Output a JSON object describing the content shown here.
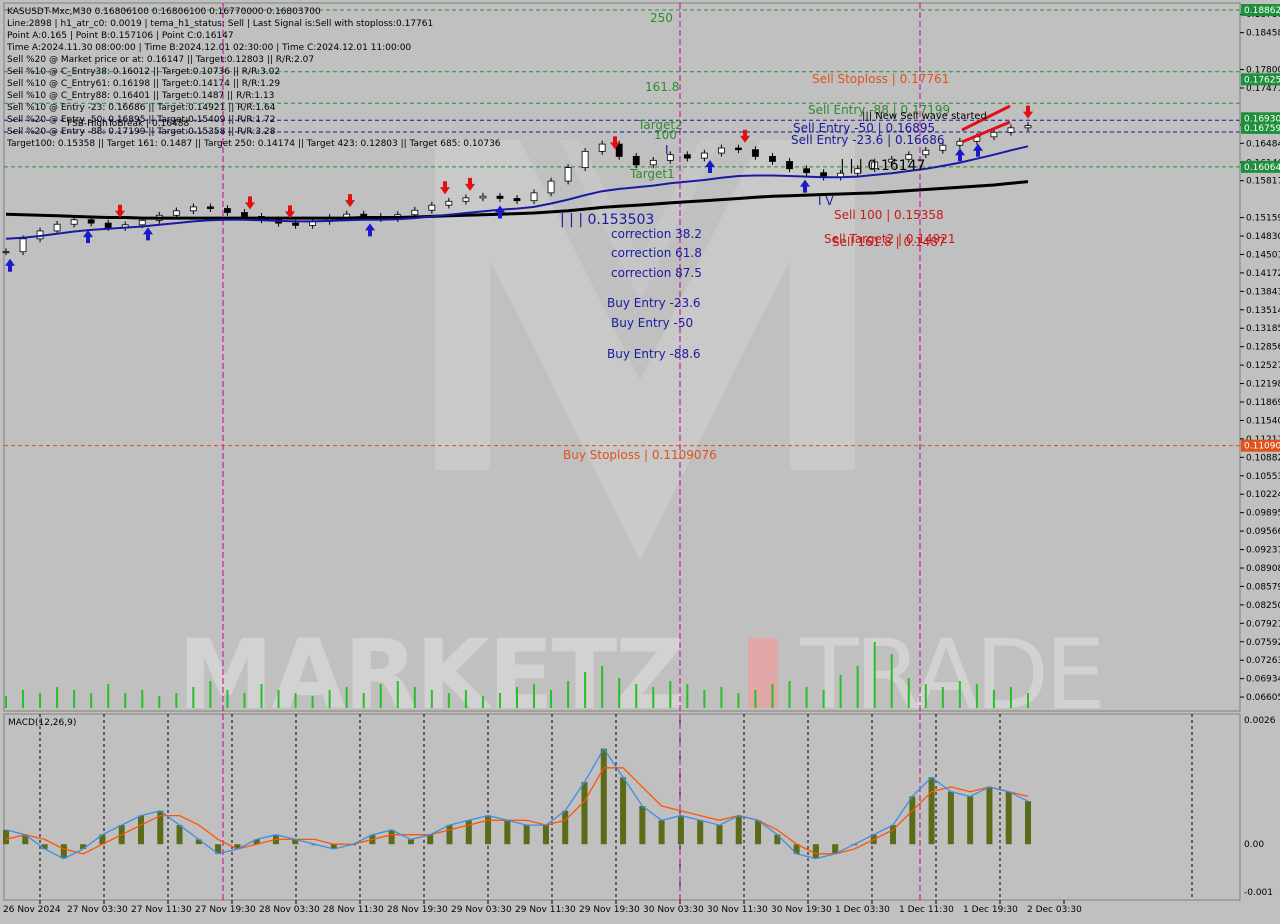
{
  "info_lines": [
    "KASUSDT-Mxc,M30  0.16806100 0.16806100 0.16770000 0.16803700",
    "Line:2898 | h1_atr_c0: 0.0019 | tema_h1_status: Sell | Last Signal is:Sell with stoploss:0.17761",
    "Point A:0.165 | Point B:0.157106 | Point C:0.16147",
    "Time A:2024.11.30 08:00:00 | Time B:2024.12.01 02:30:00 | Time C:2024.12.01 11:00:00",
    "Sell %20 @ Market price or at: 0.16147 || Target:0.12803 || R/R:2.07",
    "Sell %10 @ C_Entry38: 0.16012 || Target:0.10736 || R/R:3.02",
    "Sell %10 @ C_Entry61: 0.16198 || Target:0.14174 || R/R:1.29",
    "Sell %10 @ C_Entry88: 0.16401 || Target:0.1487 || R/R:1.13",
    "Sell %10 @ Entry -23: 0.16686 || Target:0.14921 || R/R:1.64",
    "Sell %20 @ Entry -50: 0.16895 || Target:0.15409 || R/R:1.72",
    "Sell %20 @ Entry -88: 0.17199 || Target:0.15358 || R/R:3.28",
    "Target100: 0.15358 || Target 161: 0.1487 || Target 250: 0.14174 || Target 423: 0.12803 || Target 685: 0.10736"
  ],
  "overlap_text": "FSB-HighToBreak | 0.16488",
  "price_axis": {
    "ticks": [
      "0.18787",
      "0.18458",
      "0.18129",
      "0.17800",
      "0.17471",
      "0.17142",
      "0.16813",
      "0.16484",
      "0.16146",
      "0.15817",
      "0.15488",
      "0.15159",
      "0.14830",
      "0.14501",
      "0.14172",
      "0.13843",
      "0.13514",
      "0.13185",
      "0.12856",
      "0.12527",
      "0.12198",
      "0.11869",
      "0.11540",
      "0.11211",
      "0.10882",
      "0.10553",
      "0.10224",
      "0.09895",
      "0.09566",
      "0.09237",
      "0.08908",
      "0.08579",
      "0.08250",
      "0.07921",
      "0.07592",
      "0.07263",
      "0.06934",
      "0.06605"
    ],
    "visible_ticks": [
      "0.18787",
      "0.18458",
      "0.17800",
      "0.17471",
      "0.16813",
      "0.16484",
      "0.16146",
      "0.15817",
      "0.15159",
      "0.14830",
      "0.14501",
      "0.14172",
      "0.13843",
      "0.13514",
      "0.13185",
      "0.12856",
      "0.12527",
      "0.12198",
      "0.11869",
      "0.11540",
      "0.11211",
      "0.10882",
      "0.10553",
      "0.10224",
      "0.09895",
      "0.09566",
      "0.09237",
      "0.08908",
      "0.08579",
      "0.08250",
      "0.07921",
      "0.07592",
      "0.07263",
      "0.06934",
      "0.06605"
    ]
  },
  "price_axis_labels": [
    "0.18787",
    "0.18458",
    "0.17800",
    "0.17471",
    "0.16813",
    "0.16484",
    "0.16146",
    "0.15817",
    "0.15159",
    "0.14830",
    "0.14501",
    "0.14172",
    "0.13843",
    "0.13514",
    "0.13185",
    "0.12856",
    "0.12527",
    "0.12198",
    "0.11869",
    "0.11540",
    "0.11211",
    "0.10882",
    "0.10553",
    "0.10224",
    "0.09895",
    "0.09566",
    "0.09237",
    "0.08908",
    "0.08579",
    "0.08250",
    "0.07921",
    "0.07592",
    "0.07263",
    "0.06934",
    "0.06605"
  ],
  "price_tags": [
    {
      "text": "0.18862",
      "color": "#1e8f3a",
      "price": 0.18862
    },
    {
      "text": "0.17625",
      "color": "#1e8f3a",
      "price": 0.17625
    },
    {
      "text": "0.16930",
      "color": "#1e8f3a",
      "price": 0.1693
    },
    {
      "text": "0.16759",
      "color": "#1e8f3a",
      "price": 0.16759
    },
    {
      "text": "0.16064",
      "color": "#1e8f3a",
      "price": 0.16064
    },
    {
      "text": "0.11090",
      "color": "#e0521a",
      "price": 0.1109
    }
  ],
  "macd_axis": [
    "0.0026",
    "0.00",
    "-0.001"
  ],
  "macd_label": "MACD(12,26,9)",
  "time_axis": [
    "26 Nov 2024",
    "27 Nov 03:30",
    "27 Nov 11:30",
    "27 Nov 19:30",
    "28 Nov 03:30",
    "28 Nov 11:30",
    "28 Nov 19:30",
    "29 Nov 03:30",
    "29 Nov 11:30",
    "29 Nov 19:30",
    "30 Nov 03:30",
    "30 Nov 11:30",
    "30 Nov 19:30",
    "1 Dec 03:30",
    "1 Dec 11:30",
    "1 Dec 19:30",
    "2 Dec 03:30"
  ],
  "chart_labels": {
    "t250": "250",
    "t1618": "161.8",
    "t100": "100",
    "target2": "Target2",
    "target1": "Target1",
    "sell_stoploss": "Sell Stoploss | 0.17761",
    "sell_entry_88": "Sell Entry -88 | 0.17199",
    "new_sell_wave": "||| New Sell wave started",
    "sell_entry_50": "Sell Entry -50 | 0.16895",
    "sell_entry_236": "Sell Entry -23.6 | 0.16686",
    "mid_level": "| | | 0.16147",
    "iv": "I V",
    "sell_100": "Sell 100 | 0.15358",
    "sell_target2": "Sell Target2 | 0.14921",
    "sell_1618": "Sell 161.8 | 0.1487",
    "left_level": "| | | 0.153503",
    "corr382": "correction 38.2",
    "corr618": "correction 61.8",
    "corr875": "correction 87.5",
    "buy236": "Buy Entry -23.6",
    "buy50": "Buy Entry -50",
    "buy886": "Buy Entry -88.6",
    "buy_stoploss": "Buy Stoploss | 0.1109076",
    "bar_i": "I"
  },
  "watermark": {
    "left": "MARKETZ",
    "mid": "I",
    "right": "TRADE"
  },
  "colors": {
    "bg": "#c0c0c0",
    "grid": "#a6a6a6",
    "candle": "#000000",
    "ma_blue": "#1a1aa0",
    "ma_black": "#000000",
    "red_line": "#e0521a",
    "green_line": "#2e8b2e",
    "magenta": "#c8008c",
    "macd_signal": "#ff5500",
    "macd_line": "#3b8ee8",
    "macd_hist": "#5a6b1a"
  },
  "chart_data": {
    "type": "line",
    "title": "KASUSDT-Mxc,M30",
    "ylim": [
      0.06446,
      0.18862
    ],
    "close_prices": [
      0.1455,
      0.1478,
      0.1492,
      0.1504,
      0.1512,
      0.1506,
      0.1498,
      0.1503,
      0.1511,
      0.152,
      0.1528,
      0.1535,
      0.1532,
      0.1525,
      0.1518,
      0.1512,
      0.1506,
      0.1502,
      0.1509,
      0.1516,
      0.1522,
      0.1518,
      0.1514,
      0.1521,
      0.1529,
      0.1538,
      0.1545,
      0.1551,
      0.1554,
      0.155,
      0.1546,
      0.156,
      0.1581,
      0.1605,
      0.1634,
      0.1647,
      0.1625,
      0.161,
      0.1618,
      0.1628,
      0.1622,
      0.1631,
      0.164,
      0.1637,
      0.1625,
      0.1616,
      0.1603,
      0.1596,
      0.1588,
      0.1595,
      0.1603,
      0.1615,
      0.162,
      0.1628,
      0.1636,
      0.1645,
      0.1652,
      0.166,
      0.1668,
      0.1676,
      0.168
    ],
    "ma_blue": [
      0.1478,
      0.148,
      0.1483,
      0.1487,
      0.1491,
      0.1494,
      0.1496,
      0.1498,
      0.15,
      0.1503,
      0.1506,
      0.1509,
      0.1511,
      0.1512,
      0.1512,
      0.1511,
      0.151,
      0.1509,
      0.1509,
      0.151,
      0.1511,
      0.1512,
      0.1512,
      0.1513,
      0.1515,
      0.1518,
      0.1521,
      0.1524,
      0.1527,
      0.153,
      0.1532,
      0.1535,
      0.1541,
      0.1548,
      0.1556,
      0.1563,
      0.1567,
      0.157,
      0.1573,
      0.1577,
      0.158,
      0.1583,
      0.1587,
      0.159,
      0.1591,
      0.1591,
      0.159,
      0.1589,
      0.1588,
      0.1588,
      0.1589,
      0.1592,
      0.1595,
      0.1599,
      0.1603,
      0.1608,
      0.1614,
      0.1621,
      0.1628,
      0.1636,
      0.1643
    ],
    "ma_black": [
      0.1522,
      0.1521,
      0.152,
      0.1519,
      0.1518,
      0.1517,
      0.1516,
      0.1516,
      0.1515,
      0.1515,
      0.1515,
      0.1515,
      0.1515,
      0.1515,
      0.1515,
      0.1515,
      0.1515,
      0.1515,
      0.1515,
      0.1515,
      0.1515,
      0.1516,
      0.1516,
      0.1516,
      0.1517,
      0.1518,
      0.1519,
      0.152,
      0.1521,
      0.1522,
      0.1523,
      0.1524,
      0.1526,
      0.1528,
      0.1531,
      0.1534,
      0.1536,
      0.1538,
      0.154,
      0.1542,
      0.1544,
      0.1546,
      0.1548,
      0.155,
      0.1552,
      0.1554,
      0.1555,
      0.1556,
      0.1557,
      0.1558,
      0.1559,
      0.156,
      0.1562,
      0.1564,
      0.1566,
      0.1568,
      0.157,
      0.1572,
      0.1574,
      0.1577,
      0.158
    ],
    "levels": [
      {
        "name": "Sell Stoploss",
        "value": 0.17761,
        "color": "#2e8b2e"
      },
      {
        "name": "Sell Entry -88",
        "value": 0.17199,
        "color": "#2e8b2e"
      },
      {
        "name": "Sell Entry -50",
        "value": 0.16895,
        "color": "#1a1aa0"
      },
      {
        "name": "Sell Entry -23.6",
        "value": 0.16686,
        "color": "#1a1aa0"
      },
      {
        "name": "Target1",
        "value": 0.16064,
        "color": "#2e8b2e"
      },
      {
        "name": "Buy Stoploss",
        "value": 0.1109076,
        "color": "#e0521a"
      },
      {
        "name": "Top",
        "value": 0.18862,
        "color": "#2e8b2e"
      }
    ],
    "volumes": [
      4,
      6,
      5,
      7,
      6,
      5,
      8,
      5,
      6,
      4,
      5,
      7,
      9,
      6,
      5,
      8,
      6,
      5,
      4,
      6,
      7,
      5,
      8,
      9,
      7,
      6,
      5,
      6,
      4,
      5,
      7,
      8,
      6,
      9,
      12,
      14,
      10,
      8,
      7,
      9,
      8,
      6,
      7,
      5,
      6,
      8,
      9,
      7,
      6,
      11,
      14,
      22,
      18,
      10,
      8,
      7,
      9,
      8,
      6,
      7,
      5
    ],
    "macd": {
      "ylim": [
        -0.001,
        0.0026
      ],
      "main": [
        0.0003,
        0.0002,
        -0.0001,
        -0.0003,
        -0.0001,
        0.0002,
        0.0004,
        0.0006,
        0.0007,
        0.0004,
        0.0001,
        -0.0002,
        -0.0001,
        0.0001,
        0.0002,
        0.0001,
        0.0,
        -0.0001,
        0.0,
        0.0002,
        0.0003,
        0.0001,
        0.0002,
        0.0004,
        0.0005,
        0.0006,
        0.0005,
        0.0004,
        0.0004,
        0.0007,
        0.0013,
        0.002,
        0.0014,
        0.0008,
        0.0005,
        0.0006,
        0.0005,
        0.0004,
        0.0006,
        0.0005,
        0.0002,
        -0.0002,
        -0.0003,
        -0.0002,
        0.0,
        0.0002,
        0.0004,
        0.001,
        0.0014,
        0.0011,
        0.001,
        0.0012,
        0.0011,
        0.0009
      ],
      "signal": [
        0.0001,
        0.0002,
        0.0001,
        -0.0001,
        -0.0002,
        0.0,
        0.0002,
        0.0004,
        0.0006,
        0.0006,
        0.0004,
        0.0001,
        -0.0001,
        0.0,
        0.0001,
        0.0001,
        0.0001,
        0.0,
        0.0,
        0.0001,
        0.0002,
        0.0002,
        0.0002,
        0.0003,
        0.0004,
        0.0005,
        0.0005,
        0.0005,
        0.0004,
        0.0005,
        0.0009,
        0.0016,
        0.0016,
        0.0012,
        0.0008,
        0.0007,
        0.0006,
        0.0005,
        0.0006,
        0.0005,
        0.0003,
        0.0,
        -0.0002,
        -0.0002,
        -0.0001,
        0.0001,
        0.0003,
        0.0007,
        0.0011,
        0.0012,
        0.0011,
        0.0012,
        0.0011,
        0.001
      ]
    }
  }
}
